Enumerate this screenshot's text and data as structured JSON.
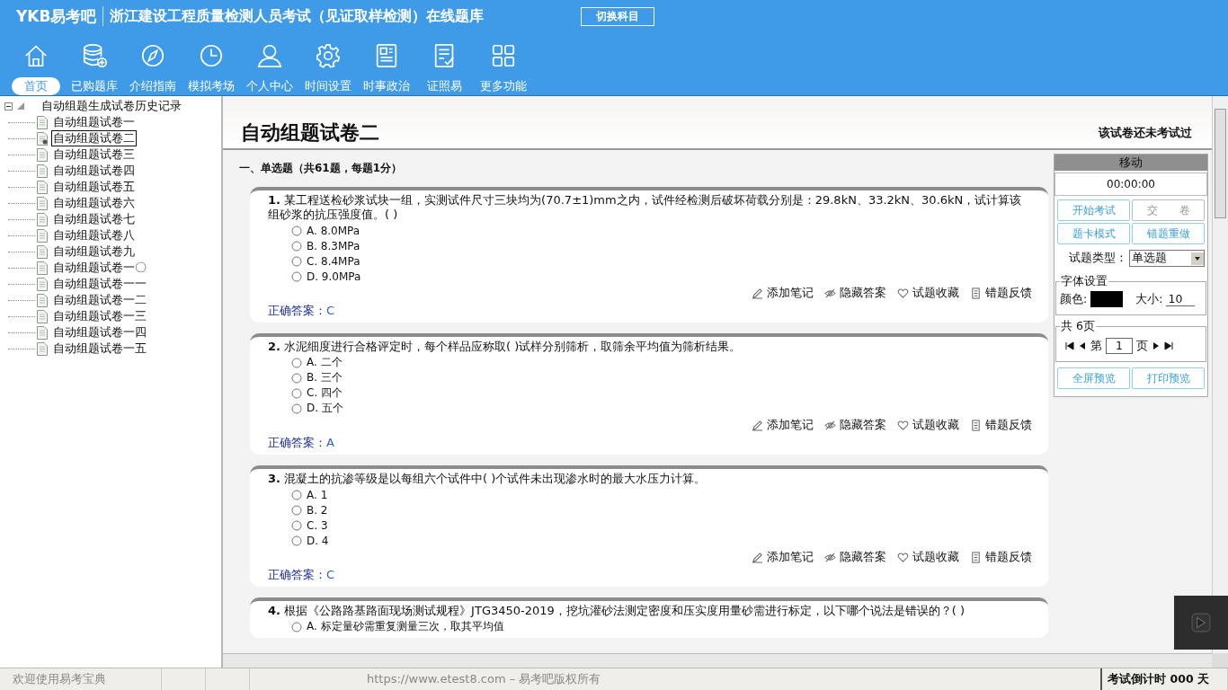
{
  "header": {
    "logo": "YKB易考吧",
    "title": "浙江建设工程质量检测人员考试（见证取样检测）在线题库",
    "switch_button": "切换科目"
  },
  "nav": [
    {
      "label": "首页",
      "kind": "home",
      "selected": true
    },
    {
      "label": "已购题库",
      "kind": "database",
      "selected": false
    },
    {
      "label": "介绍指南",
      "kind": "compass",
      "selected": false
    },
    {
      "label": "模拟考场",
      "kind": "clock",
      "selected": false
    },
    {
      "label": "个人中心",
      "kind": "person",
      "selected": false
    },
    {
      "label": "时间设置",
      "kind": "gear",
      "selected": false
    },
    {
      "label": "时事政治",
      "kind": "news",
      "selected": false
    },
    {
      "label": "证照易",
      "kind": "checklist",
      "selected": false
    },
    {
      "label": "更多功能",
      "kind": "grid",
      "selected": false
    }
  ],
  "tree": {
    "root": "自动组题生成试卷历史记录",
    "expanded": true,
    "children": [
      {
        "label": "自动组题试卷一",
        "selected": false
      },
      {
        "label": "自动组题试卷二",
        "selected": true
      },
      {
        "label": "自动组题试卷三",
        "selected": false
      },
      {
        "label": "自动组题试卷四",
        "selected": false
      },
      {
        "label": "自动组题试卷五",
        "selected": false
      },
      {
        "label": "自动组题试卷六",
        "selected": false
      },
      {
        "label": "自动组题试卷七",
        "selected": false
      },
      {
        "label": "自动组题试卷八",
        "selected": false
      },
      {
        "label": "自动组题试卷九",
        "selected": false
      },
      {
        "label": "自动组题试卷一〇",
        "selected": false
      },
      {
        "label": "自动组题试卷一一",
        "selected": false
      },
      {
        "label": "自动组题试卷一二",
        "selected": false
      },
      {
        "label": "自动组题试卷一三",
        "selected": false
      },
      {
        "label": "自动组题试卷一四",
        "selected": false
      },
      {
        "label": "自动组题试卷一五",
        "selected": false
      }
    ]
  },
  "paper": {
    "title": "自动组题试卷二",
    "status": "该试卷还未考试过",
    "section": "一、单选题（共61题，每题1分）",
    "questions": [
      {
        "number": "1.",
        "text": "某工程送检砂浆试块一组，实测试件尺寸三块均为(70.7±1)mm之内，试件经检测后破坏荷载分别是：29.8kN、33.2kN、30.6kN，试计算该组砂浆的抗压强度值。( )",
        "options": [
          {
            "letter": "A.",
            "text": "8.0MPa",
            "selected": false
          },
          {
            "letter": "B.",
            "text": "8.3MPa",
            "selected": false
          },
          {
            "letter": "C.",
            "text": "8.4MPa",
            "selected": false
          },
          {
            "letter": "D.",
            "text": "9.0MPa",
            "selected": false
          }
        ],
        "actions": [
          {
            "label": "添加笔记",
            "kind": "pencil"
          },
          {
            "label": "隐藏答案",
            "kind": "eye"
          },
          {
            "label": "试题收藏",
            "kind": "heart"
          },
          {
            "label": "错题反馈",
            "kind": "report"
          }
        ],
        "answer_label": "正确答案：",
        "answer": "C"
      },
      {
        "number": "2.",
        "text": "水泥细度进行合格评定时，每个样品应称取( )试样分别筛析，取筛余平均值为筛析结果。",
        "options": [
          {
            "letter": "A.",
            "text": "二个",
            "selected": false
          },
          {
            "letter": "B.",
            "text": "三个",
            "selected": false
          },
          {
            "letter": "C.",
            "text": "四个",
            "selected": false
          },
          {
            "letter": "D.",
            "text": "五个",
            "selected": false
          }
        ],
        "actions": [
          {
            "label": "添加笔记",
            "kind": "pencil"
          },
          {
            "label": "隐藏答案",
            "kind": "eye"
          },
          {
            "label": "试题收藏",
            "kind": "heart"
          },
          {
            "label": "错题反馈",
            "kind": "report"
          }
        ],
        "answer_label": "正确答案：",
        "answer": "A"
      },
      {
        "number": "3.",
        "text": "混凝土的抗渗等级是以每组六个试件中( )个试件未出现渗水时的最大水压力计算。",
        "options": [
          {
            "letter": "A.",
            "text": "1",
            "selected": false
          },
          {
            "letter": "B.",
            "text": "2",
            "selected": false
          },
          {
            "letter": "C.",
            "text": "3",
            "selected": false
          },
          {
            "letter": "D.",
            "text": "4",
            "selected": false
          }
        ],
        "actions": [
          {
            "label": "添加笔记",
            "kind": "pencil"
          },
          {
            "label": "隐藏答案",
            "kind": "eye"
          },
          {
            "label": "试题收藏",
            "kind": "heart"
          },
          {
            "label": "错题反馈",
            "kind": "report"
          }
        ],
        "answer_label": "正确答案：",
        "answer": "C"
      },
      {
        "number": "4.",
        "text": "根据《公路路基路面现场测试规程》JTG3450-2019，挖坑灌砂法测定密度和压实度用量砂需进行标定，以下哪个说法是错误的？( )",
        "options": [
          {
            "letter": "A.",
            "text": "标定量砂需重复测量三次，取其平均值",
            "selected": false
          }
        ]
      }
    ]
  },
  "panel": {
    "title": "移动",
    "timer": "00:00:00",
    "buttons": [
      {
        "label": "开始考试",
        "disabled": false
      },
      {
        "label": "交　　卷",
        "disabled": true
      },
      {
        "label": "题卡模式",
        "disabled": false
      },
      {
        "label": "错题重做",
        "disabled": false
      }
    ],
    "type_label": "试题类型：",
    "type_value": "单选题",
    "font_group": "字体设置",
    "color_label": "颜色:",
    "color": "#000000",
    "size_label": "大小:",
    "size_value": "10",
    "page_group": "共 6页",
    "page_prefix": "第",
    "page_value": "1",
    "page_suffix": "页",
    "bottom_buttons": [
      "全屏预览",
      "打印预览"
    ]
  },
  "status_bar": {
    "welcome": "欢迎使用易考宝典",
    "copyright": "https://www.etest8.com – 易考吧版权所有",
    "countdown": "考试倒计时 000 天"
  }
}
